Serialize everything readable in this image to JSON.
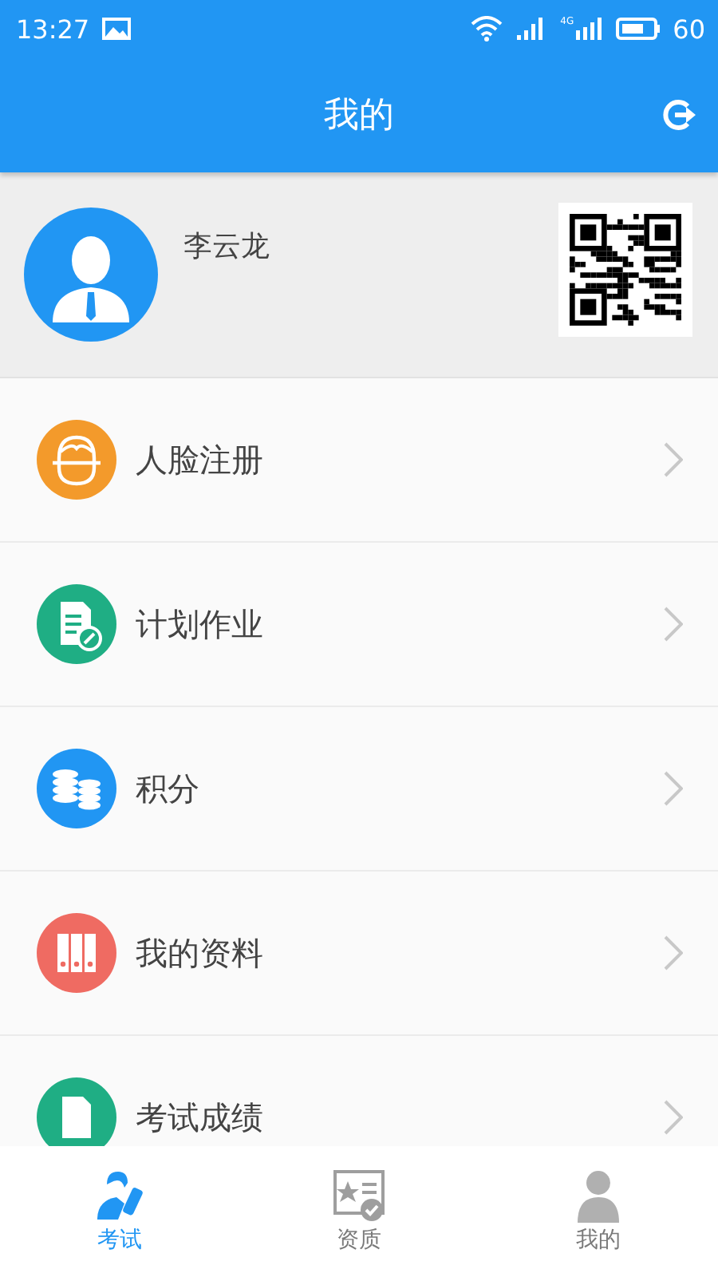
{
  "status_bar": {
    "time": "13:27",
    "network": "4G",
    "battery_text": "60"
  },
  "header": {
    "title": "我的"
  },
  "profile": {
    "name": "李云龙"
  },
  "menu": [
    {
      "label": "人脸注册",
      "kind": "face",
      "color": "#f39a2b"
    },
    {
      "label": "计划作业",
      "kind": "plan",
      "color": "#1fae84"
    },
    {
      "label": "积分",
      "kind": "coins",
      "color": "#2196f3"
    },
    {
      "label": "我的资料",
      "kind": "files",
      "color": "#ef6b62"
    },
    {
      "label": "考试成绩",
      "kind": "doc",
      "color": "#1fae84"
    }
  ],
  "tabs": [
    {
      "label": "考试",
      "kind": "exam",
      "selected": true
    },
    {
      "label": "资质",
      "kind": "cert",
      "selected": false
    },
    {
      "label": "我的",
      "kind": "me",
      "selected": false
    }
  ]
}
